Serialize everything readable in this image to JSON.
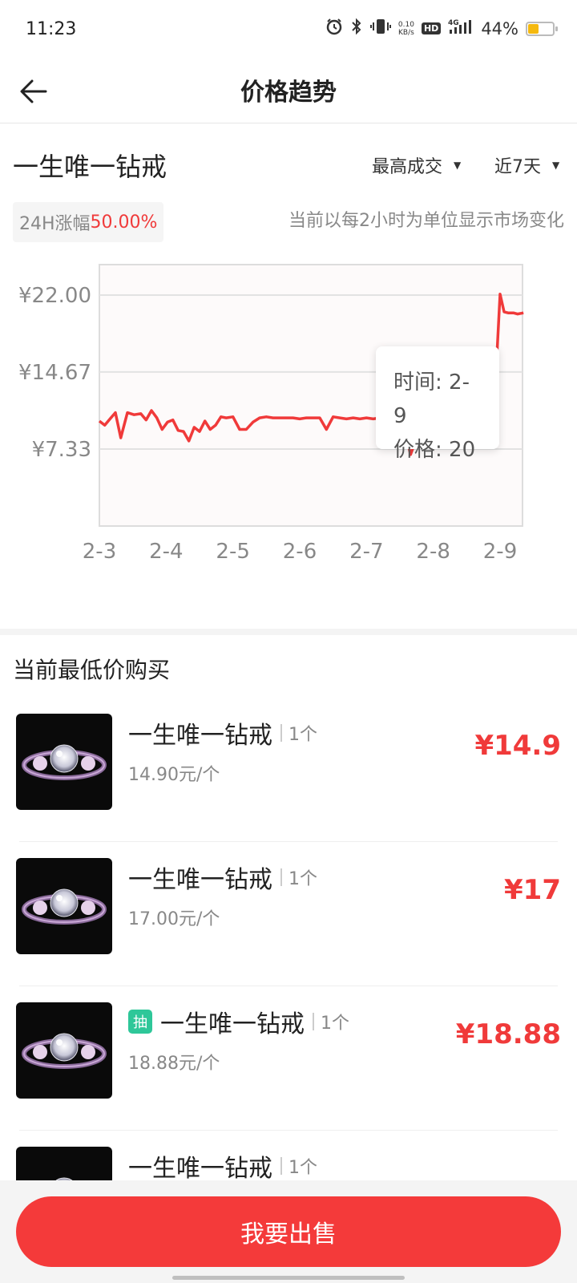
{
  "status_bar": {
    "time": "11:23",
    "netspeed_value": "0.10",
    "netspeed_unit": "KB/s",
    "hd": "HD",
    "network": "4G",
    "battery": "44%",
    "battery_level": 0.44
  },
  "nav": {
    "title": "价格趋势"
  },
  "header": {
    "item_title": "一生唯一钻戒",
    "filter_type": "最高成交",
    "filter_range": "近7天",
    "change_label": "24H涨幅",
    "change_value": "50.00%",
    "hint": "当前以每2小时为单位显示市场变化"
  },
  "chart_data": {
    "type": "line",
    "y_ticks": [
      "¥22.00",
      "¥14.67",
      "¥7.33"
    ],
    "y_tick_values": [
      22.0,
      14.67,
      7.33
    ],
    "x_ticks": [
      "2-3",
      "2-4",
      "2-5",
      "2-6",
      "2-7",
      "2-8",
      "2-9"
    ],
    "ylim": [
      0,
      25
    ],
    "xlim": [
      0,
      6.35
    ],
    "line_color": "#f03a3a",
    "points": [
      [
        0,
        10
      ],
      [
        0.08,
        9.6
      ],
      [
        0.16,
        10.2
      ],
      [
        0.24,
        10.8
      ],
      [
        0.32,
        8.4
      ],
      [
        0.42,
        10.8
      ],
      [
        0.52,
        10.6
      ],
      [
        0.62,
        10.7
      ],
      [
        0.7,
        10.1
      ],
      [
        0.78,
        11
      ],
      [
        0.86,
        10.3
      ],
      [
        0.94,
        9.2
      ],
      [
        1.02,
        9.9
      ],
      [
        1.1,
        10.1
      ],
      [
        1.18,
        9.1
      ],
      [
        1.26,
        9
      ],
      [
        1.34,
        8.1
      ],
      [
        1.42,
        9.4
      ],
      [
        1.5,
        9
      ],
      [
        1.58,
        10
      ],
      [
        1.66,
        9.2
      ],
      [
        1.74,
        9.6
      ],
      [
        1.82,
        10.4
      ],
      [
        1.9,
        10.3
      ],
      [
        2.0,
        10.4
      ],
      [
        2.1,
        9.2
      ],
      [
        2.2,
        9.2
      ],
      [
        2.3,
        9.9
      ],
      [
        2.4,
        10.3
      ],
      [
        2.5,
        10.4
      ],
      [
        2.6,
        10.3
      ],
      [
        2.7,
        10.3
      ],
      [
        2.8,
        10.3
      ],
      [
        2.9,
        10.3
      ],
      [
        3.0,
        10.2
      ],
      [
        3.1,
        10.3
      ],
      [
        3.2,
        10.3
      ],
      [
        3.3,
        10.3
      ],
      [
        3.4,
        9.2
      ],
      [
        3.5,
        10.4
      ],
      [
        3.6,
        10.3
      ],
      [
        3.7,
        10.2
      ],
      [
        3.8,
        10.3
      ],
      [
        3.9,
        10.2
      ],
      [
        4.0,
        10.3
      ],
      [
        4.1,
        10.2
      ],
      [
        4.2,
        10.3
      ],
      [
        4.3,
        10.2
      ],
      [
        4.4,
        9.2
      ],
      [
        4.52,
        9.5
      ],
      [
        4.6,
        8.4
      ],
      [
        4.66,
        6.8
      ],
      [
        4.74,
        8.2
      ],
      [
        4.82,
        9.6
      ],
      [
        4.9,
        10
      ],
      [
        5.0,
        10.2
      ],
      [
        5.1,
        10
      ],
      [
        5.2,
        9.6
      ],
      [
        5.3,
        9.8
      ],
      [
        5.4,
        9.9
      ],
      [
        5.5,
        8.2
      ],
      [
        5.6,
        9.6
      ],
      [
        5.7,
        10
      ],
      [
        5.8,
        9.4
      ],
      [
        5.88,
        13.3
      ],
      [
        5.94,
        14.7
      ],
      [
        6.0,
        22.1
      ],
      [
        6.06,
        20.4
      ],
      [
        6.12,
        20.3
      ],
      [
        6.2,
        20.3
      ],
      [
        6.26,
        20.2
      ],
      [
        6.35,
        20.3
      ]
    ],
    "tooltip": {
      "time_label": "时间: 2-9",
      "price_label": "价格: 20"
    }
  },
  "listing_section": {
    "title": "当前最低价购买",
    "items": [
      {
        "name": "一生唯一钻戒",
        "qty": "1个",
        "unit_price": "14.90元/个",
        "price": "¥14.9",
        "badge": ""
      },
      {
        "name": "一生唯一钻戒",
        "qty": "1个",
        "unit_price": "17.00元/个",
        "price": "¥17",
        "badge": ""
      },
      {
        "name": "一生唯一钻戒",
        "qty": "1个",
        "unit_price": "18.88元/个",
        "price": "¥18.88",
        "badge": "抽"
      },
      {
        "name": "一生唯一钻戒",
        "qty": "1个",
        "unit_price": "",
        "price": "",
        "badge": ""
      }
    ]
  },
  "bottom": {
    "sell_label": "我要出售"
  },
  "colors": {
    "accent": "#f43a3a",
    "price_red": "#f03a3a",
    "badge_green": "#2ec799"
  }
}
